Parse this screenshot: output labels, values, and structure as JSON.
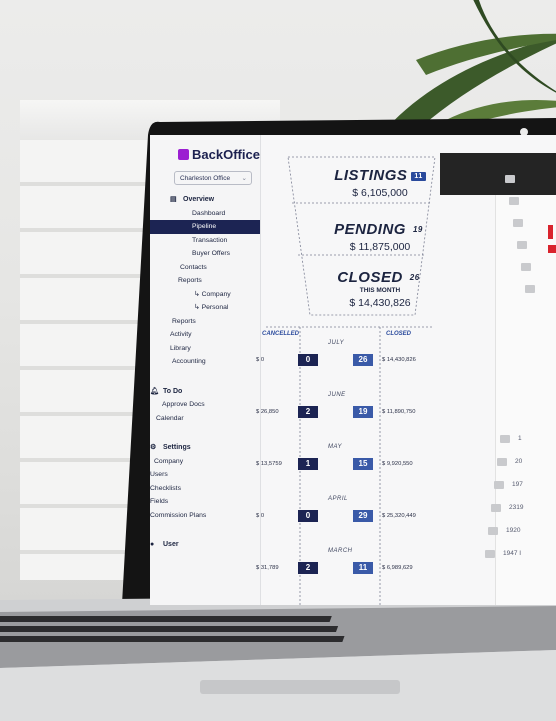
{
  "app": {
    "name": "BackOffice",
    "office": "Charleston Office"
  },
  "sidebar": {
    "overview": "Overview",
    "items": [
      {
        "label": "Dashboard",
        "level": "sub"
      },
      {
        "label": "Pipeline",
        "level": "sub",
        "active": true
      },
      {
        "label": "Transaction",
        "level": "sub"
      },
      {
        "label": "Buyer Offers",
        "level": "sub"
      },
      {
        "label": "Contacts",
        "level": "main"
      },
      {
        "label": "Reports",
        "level": "main"
      },
      {
        "label": "↳  Company",
        "level": "subsub"
      },
      {
        "label": "↳  Personal",
        "level": "subsub"
      },
      {
        "label": "Reports",
        "level": "main"
      },
      {
        "label": "Activity",
        "level": "main"
      },
      {
        "label": "Library",
        "level": "main"
      },
      {
        "label": "Accounting",
        "level": "main"
      }
    ],
    "todo": "To Do",
    "todo_items": [
      "Approve Docs",
      "Calendar"
    ],
    "settings": "Settings",
    "settings_items": [
      "Company",
      "Users",
      "Checklists",
      "Fields",
      "Commission Plans"
    ],
    "user": "User"
  },
  "funnel": {
    "listings": {
      "title": "LISTINGS",
      "count": "11",
      "amount": "$ 6,105,000"
    },
    "pending": {
      "title": "PENDING",
      "count": "19",
      "amount": "$ 11,875,000"
    },
    "closed": {
      "title": "CLOSED",
      "count": "26",
      "sub": "THIS MONTH",
      "amount": "$ 14,430,826"
    }
  },
  "breakdown": {
    "cancelled_label": "CANCELLED",
    "closed_label": "CLOSED",
    "months": [
      {
        "name": "JULY",
        "cancelled_amt": "$ 0",
        "cancelled": "0",
        "closed": "26",
        "closed_amt": "$ 14,430,826"
      },
      {
        "name": "JUNE",
        "cancelled_amt": "$ 26,850",
        "cancelled": "2",
        "closed": "19",
        "closed_amt": "$ 11,890,750"
      },
      {
        "name": "MAY",
        "cancelled_amt": "$ 13,5759",
        "cancelled": "1",
        "closed": "15",
        "closed_amt": "$ 9,920,550"
      },
      {
        "name": "APRIL",
        "cancelled_amt": "$ 0",
        "cancelled": "0",
        "closed": "29",
        "closed_amt": "$ 25,320,449"
      },
      {
        "name": "MARCH",
        "cancelled_amt": "$ 31,789",
        "cancelled": "2",
        "closed": "11",
        "closed_amt": "$ 6,989,629"
      }
    ]
  },
  "right_rows": [
    "1",
    "20",
    "197",
    "2319",
    "1920",
    "1947 I"
  ],
  "colors": {
    "navy": "#1c2453",
    "accent_blue": "#2a4a9c",
    "brand_purple": "#9b1fd1",
    "alert_red": "#d9232d"
  }
}
